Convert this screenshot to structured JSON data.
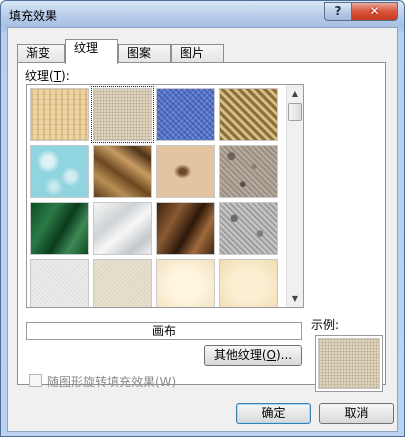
{
  "window": {
    "title": "填充效果",
    "help": "?",
    "close": "✕"
  },
  "tabs": [
    {
      "label": "渐变",
      "active": false
    },
    {
      "label": "纹理",
      "active": true
    },
    {
      "label": "图案",
      "active": false
    },
    {
      "label": "图片",
      "active": false
    }
  ],
  "texture_section": {
    "label_prefix": "纹理(",
    "label_key": "T",
    "label_suffix": "):"
  },
  "textures": [
    {
      "name": "papyrus",
      "selected": false
    },
    {
      "name": "canvas",
      "selected": true
    },
    {
      "name": "denim",
      "selected": false
    },
    {
      "name": "woven-mat",
      "selected": false
    },
    {
      "name": "water-droplets",
      "selected": false
    },
    {
      "name": "paper-bag",
      "selected": false
    },
    {
      "name": "fish-fossil",
      "selected": false
    },
    {
      "name": "sand",
      "selected": false
    },
    {
      "name": "green-marble",
      "selected": false
    },
    {
      "name": "white-marble",
      "selected": false
    },
    {
      "name": "brown-marble",
      "selected": false
    },
    {
      "name": "granite",
      "selected": false
    },
    {
      "name": "newsprint",
      "selected": false
    },
    {
      "name": "recycled-paper",
      "selected": false
    },
    {
      "name": "parchment",
      "selected": false
    },
    {
      "name": "stationery",
      "selected": false
    }
  ],
  "selected_texture_name": "画布",
  "other_texture_button": {
    "prefix": "其他纹理(",
    "key": "O",
    "suffix": ")..."
  },
  "preview_label": "示例:",
  "rotate_checkbox": {
    "label": "随图形旋转填充效果(W)",
    "checked": false,
    "enabled": false
  },
  "ok_label": "确定",
  "cancel_label": "取消",
  "scrollbar": {
    "up": "▲",
    "down": "▼"
  }
}
